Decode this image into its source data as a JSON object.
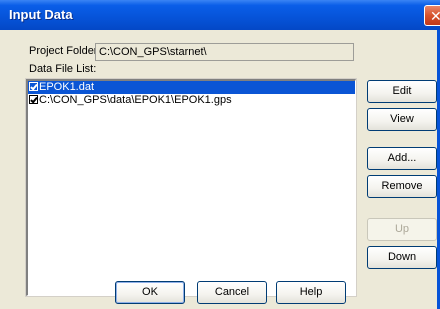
{
  "window": {
    "title": "Input Data",
    "close_glyph": "✕"
  },
  "project": {
    "label": "Project Folder:",
    "value": "C:\\CON_GPS\\starnet\\"
  },
  "data_files": {
    "label": "Data File List:",
    "items": [
      {
        "name": "EPOK1.dat",
        "checked": true,
        "selected": true
      },
      {
        "name": "C:\\CON_GPS\\data\\EPOK1\\EPOK1.gps",
        "checked": true,
        "selected": false
      }
    ]
  },
  "side_buttons": {
    "edit": "Edit",
    "view": "View",
    "add": "Add...",
    "remove": "Remove",
    "up": "Up",
    "down": "Down"
  },
  "footer_buttons": {
    "ok": "OK",
    "cancel": "Cancel",
    "help": "Help"
  },
  "colors": {
    "titlebar": "#0653d8",
    "dialog_bg": "#ece9d8",
    "selection": "#0a55d5"
  }
}
